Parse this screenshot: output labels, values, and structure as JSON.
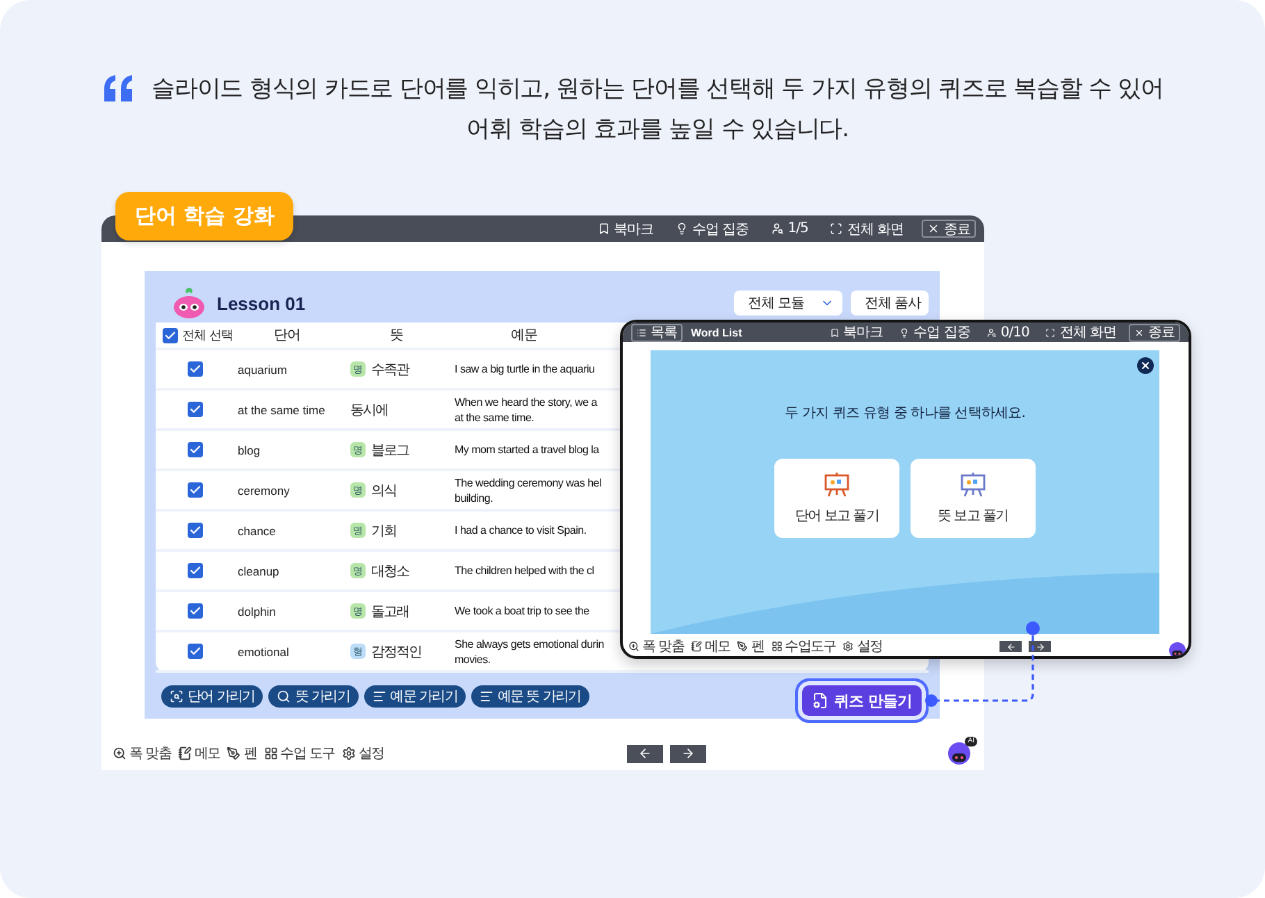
{
  "quote": {
    "lines": [
      "슬라이드 형식의 카드로 단어를 익히고, 원하는 단어를 선택해 두 가지 유형의 퀴즈로 복습할 수 있어",
      "어휘 학습의 효과를 높일 수 있습니다."
    ]
  },
  "badge": "단어 학습 강화",
  "main_window": {
    "toolbar": [
      {
        "kind": "bookmark",
        "label": "북마크"
      },
      {
        "kind": "focus",
        "label": "수업 집중"
      },
      {
        "kind": "page",
        "label": "1/5"
      },
      {
        "kind": "fullscreen",
        "label": "전체 화면"
      },
      {
        "kind": "exit",
        "label": "종료"
      }
    ],
    "lesson": "Lesson 01",
    "filters": [
      "전체 모듈",
      "전체 품사"
    ],
    "table": {
      "select_all": {
        "label": "전체 선택",
        "checked": true
      },
      "columns": [
        "단어",
        "뜻",
        "예문"
      ],
      "rows": [
        {
          "checked": true,
          "word": "aquarium",
          "pos": {
            "text": "명",
            "color": "#b8e6a8"
          },
          "meaning": "수족관",
          "example": [
            "I saw a big turtle in the aquariu"
          ]
        },
        {
          "checked": true,
          "word": "at the same time",
          "meaning": "동시에",
          "example": [
            "When we heard the story, we a",
            "at the same time."
          ]
        },
        {
          "checked": true,
          "word": "blog",
          "pos": {
            "text": "명",
            "color": "#b8e6a8"
          },
          "meaning": "블로그",
          "example": [
            "My mom started a travel blog la"
          ]
        },
        {
          "checked": true,
          "word": "ceremony",
          "pos": {
            "text": "명",
            "color": "#b8e6a8"
          },
          "meaning": "의식",
          "example": [
            "The wedding ceremony was hel",
            "building."
          ]
        },
        {
          "checked": true,
          "word": "chance",
          "pos": {
            "text": "명",
            "color": "#b8e6a8"
          },
          "meaning": "기회",
          "example": [
            "I had a chance to visit Spain."
          ]
        },
        {
          "checked": true,
          "word": "cleanup",
          "pos": {
            "text": "명",
            "color": "#b8e6a8"
          },
          "meaning": "대청소",
          "example": [
            "The children helped with the cl"
          ]
        },
        {
          "checked": true,
          "word": "dolphin",
          "pos": {
            "text": "명",
            "color": "#b8e6a8"
          },
          "meaning": "돌고래",
          "example": [
            "We took a boat trip to see the"
          ]
        },
        {
          "checked": true,
          "word": "emotional",
          "pos": {
            "text": "형",
            "color": "#bcdcf7"
          },
          "meaning": "감정적인",
          "example": [
            "She always gets emotional durin",
            "movies."
          ]
        }
      ]
    },
    "actions": [
      {
        "kind": "word",
        "label": "단어 가리기"
      },
      {
        "kind": "meaning",
        "label": "뜻 가리기"
      },
      {
        "kind": "example",
        "label": "예문 가리기"
      },
      {
        "kind": "example",
        "label": "예문 뜻 가리기"
      }
    ],
    "bottom_tools": [
      {
        "kind": "fit",
        "label": "폭 맞춤"
      },
      {
        "kind": "memo",
        "label": "메모"
      },
      {
        "kind": "pen",
        "label": "펜"
      },
      {
        "kind": "tools",
        "label": "수업 도구"
      },
      {
        "kind": "settings",
        "label": "설정"
      }
    ],
    "avatar_badge": "AI"
  },
  "quiz_window": {
    "list_button": "목록",
    "title": "Word List",
    "toolbar": [
      {
        "kind": "bookmark",
        "label": "북마크"
      },
      {
        "kind": "focus",
        "label": "수업 집중"
      },
      {
        "kind": "page",
        "label": "0/10"
      },
      {
        "kind": "fullscreen",
        "label": "전체 화면"
      },
      {
        "kind": "exit",
        "label": "종료"
      }
    ],
    "prompt": "두 가지 퀴즈 유형 중 하나를 선택하세요.",
    "options": [
      {
        "kind": "word",
        "label": "단어 보고 풀기"
      },
      {
        "kind": "meaning",
        "label": "뜻 보고 풀기"
      }
    ],
    "bottom_tools": [
      {
        "kind": "fit",
        "label": "폭 맞춤"
      },
      {
        "kind": "memo",
        "label": "메모"
      },
      {
        "kind": "pen",
        "label": "펜"
      },
      {
        "kind": "tools",
        "label": "수업도구"
      },
      {
        "kind": "settings",
        "label": "설정"
      }
    ]
  },
  "quiz_button": "퀴즈 만들기"
}
